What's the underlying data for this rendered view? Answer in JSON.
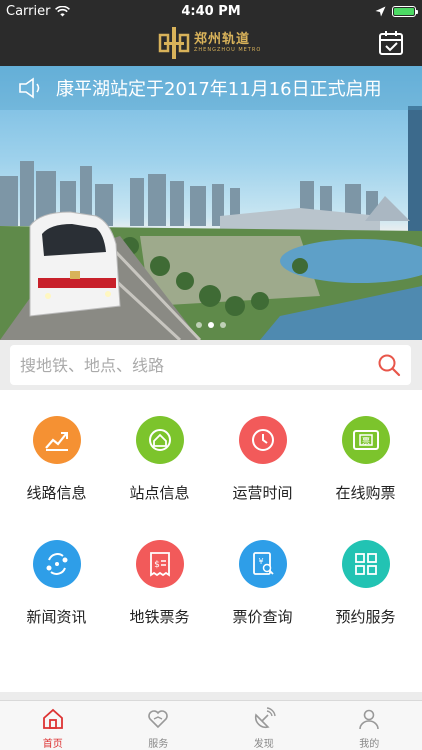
{
  "status": {
    "carrier": "Carrier",
    "time": "4:40 PM"
  },
  "header": {
    "logo_cn": "郑州轨道",
    "logo_en": "ZHENGZHOU METRO"
  },
  "banner": {
    "notice": "康平湖站定于2017年11月16日正式启用",
    "slides": 3,
    "active_slide": 2
  },
  "search": {
    "placeholder": "搜地铁、地点、线路"
  },
  "grid": [
    {
      "label": "线路信息",
      "color": "#f59133",
      "icon": "route-chart-icon"
    },
    {
      "label": "站点信息",
      "color": "#7cc42c",
      "icon": "station-icon"
    },
    {
      "label": "运营时间",
      "color": "#f25a5a",
      "icon": "clock-icon"
    },
    {
      "label": "在线购票",
      "color": "#7cc42c",
      "icon": "ticket-icon"
    },
    {
      "label": "新闻资讯",
      "color": "#2e9ee8",
      "icon": "news-icon"
    },
    {
      "label": "地铁票务",
      "color": "#f25a5a",
      "icon": "receipt-icon"
    },
    {
      "label": "票价查询",
      "color": "#2e9ee8",
      "icon": "fare-search-icon"
    },
    {
      "label": "预约服务",
      "color": "#22c3b3",
      "icon": "reservation-icon"
    }
  ],
  "tabs": [
    {
      "label": "首页",
      "active": true
    },
    {
      "label": "服务",
      "active": false
    },
    {
      "label": "发现",
      "active": false
    },
    {
      "label": "我的",
      "active": false
    }
  ],
  "colors": {
    "accent": "#d33333",
    "navbar": "#2b2b2b"
  }
}
